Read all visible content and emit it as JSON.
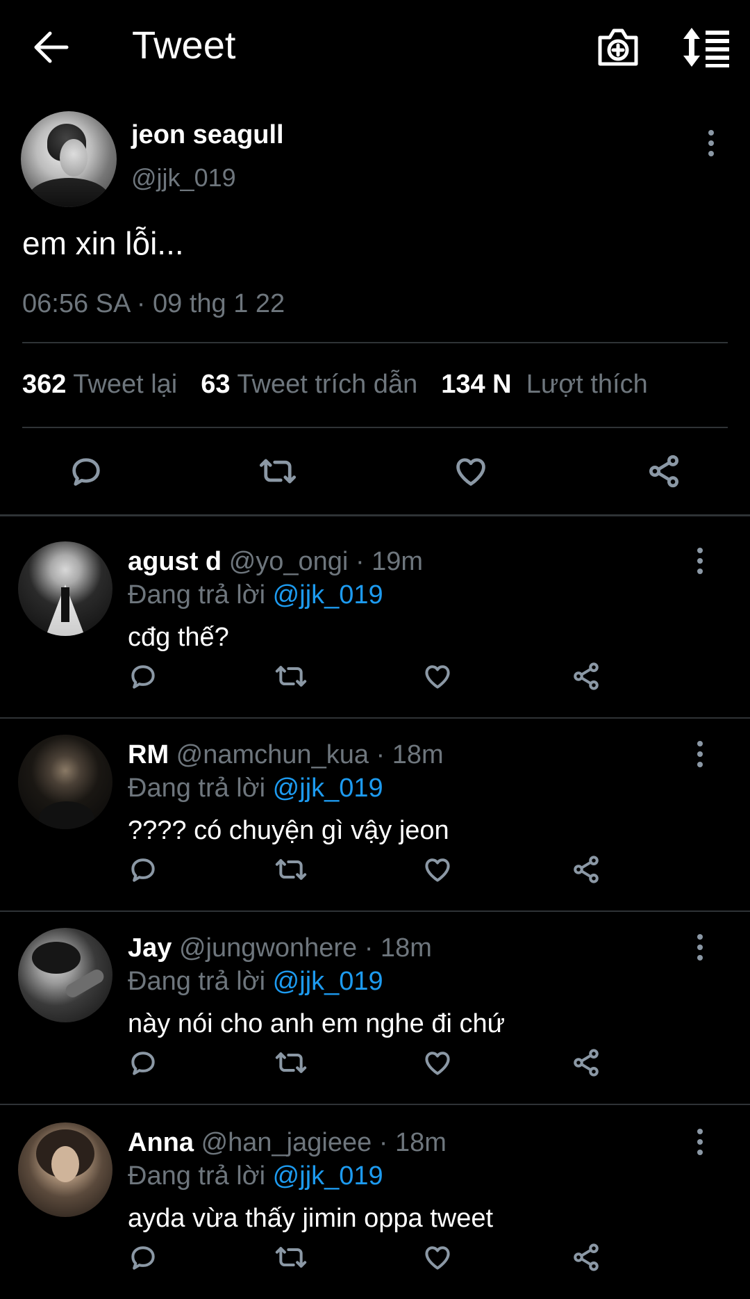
{
  "header": {
    "title": "Tweet",
    "back_icon": "arrow-left-icon",
    "camera_icon": "camera-plus-icon",
    "sort_icon": "sort-list-icon"
  },
  "tweet": {
    "author_name": "jeon seagull",
    "author_handle": "@jjk_019",
    "text": "em xin lỗi...",
    "timestamp": "06:56 SA · 09 thg 1 22",
    "stats": {
      "retweets_count": "362",
      "retweets_label": "Tweet lại",
      "quotes_count": "63",
      "quotes_label": "Tweet trích dẫn",
      "likes_count": "134 N",
      "likes_label": "Lượt thích"
    }
  },
  "replies": [
    {
      "name": "agust d",
      "handle": "@yo_ongi",
      "time": "· 19m",
      "replying_prefix": "Đang trả lời",
      "replying_to": "@jjk_019",
      "text": "cđg thế?"
    },
    {
      "name": "RM",
      "handle": "@namchun_kua",
      "time": "· 18m",
      "replying_prefix": "Đang trả lời",
      "replying_to": "@jjk_019",
      "text": "???? có chuyện gì vậy jeon"
    },
    {
      "name": "Jay",
      "handle": "@jungwonhere",
      "time": "· 18m",
      "replying_prefix": "Đang trả lời",
      "replying_to": "@jjk_019",
      "text": "này nói cho anh em nghe đi chứ"
    },
    {
      "name": "Anna",
      "handle": "@han_jagieee",
      "time": "· 18m",
      "replying_prefix": "Đang trả lời",
      "replying_to": "@jjk_019",
      "text": "ayda vừa thấy jimin oppa tweet"
    }
  ],
  "colors": {
    "background": "#000000",
    "secondary_text": "#6e767d",
    "mention": "#1d9bf0",
    "divider": "#2f3336",
    "icon": "#8b98a5"
  }
}
